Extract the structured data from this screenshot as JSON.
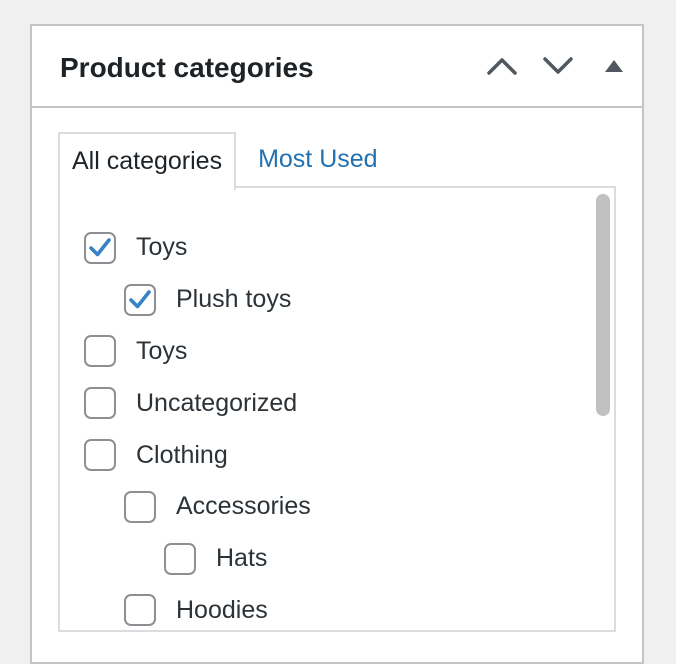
{
  "panel": {
    "title": "Product categories",
    "controls": {
      "move_up_icon": "chevron-up-icon",
      "move_down_icon": "chevron-down-icon",
      "toggle_icon": "triangle-up-icon"
    }
  },
  "tabs": [
    {
      "label": "All categories",
      "active": true
    },
    {
      "label": "Most Used",
      "active": false
    }
  ],
  "categories": [
    {
      "label": "Toys",
      "checked": true,
      "depth": 0
    },
    {
      "label": "Plush toys",
      "checked": true,
      "depth": 1
    },
    {
      "label": "Toys",
      "checked": false,
      "depth": 0
    },
    {
      "label": "Uncategorized",
      "checked": false,
      "depth": 0
    },
    {
      "label": "Clothing",
      "checked": false,
      "depth": 0
    },
    {
      "label": "Accessories",
      "checked": false,
      "depth": 1
    },
    {
      "label": "Hats",
      "checked": false,
      "depth": 2
    },
    {
      "label": "Hoodies",
      "checked": false,
      "depth": 1
    }
  ],
  "colors": {
    "accent": "#2271b1",
    "checkmark": "#3582c4",
    "border": "#c3c4c7",
    "text": "#1d2327"
  }
}
